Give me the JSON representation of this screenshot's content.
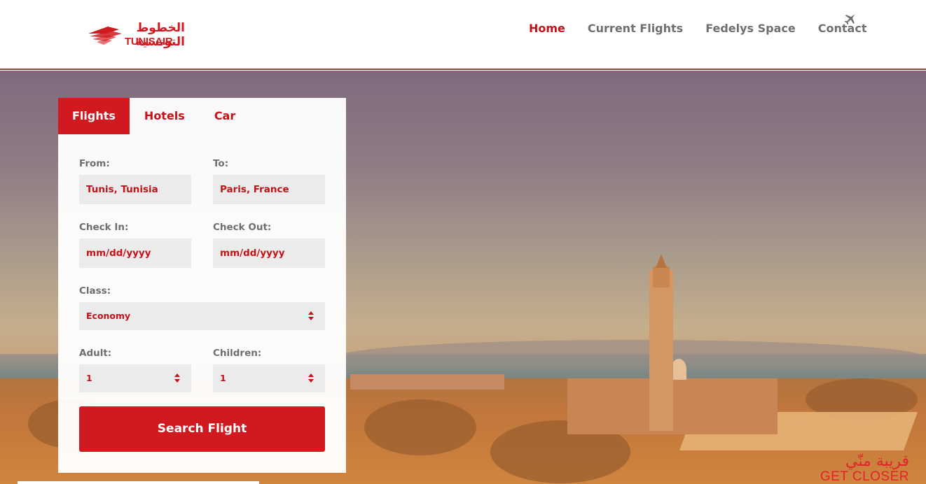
{
  "header": {
    "logo_arabic": "الخطوط التونسية",
    "logo_text": "TUNISAIR",
    "nav": [
      {
        "label": "Home",
        "active": true
      },
      {
        "label": "Current Flights",
        "active": false
      },
      {
        "label": "Fedelys Space",
        "active": false
      },
      {
        "label": "Contact",
        "active": false
      }
    ],
    "nav_icon": "plane-icon"
  },
  "search": {
    "tabs": [
      {
        "label": "Flights",
        "active": true
      },
      {
        "label": "Hotels",
        "active": false
      },
      {
        "label": "Car",
        "active": false
      }
    ],
    "from_label": "From:",
    "from_value": "Tunis, Tunisia",
    "to_label": "To:",
    "to_value": "Paris, France",
    "checkin_label": "Check In:",
    "checkin_value": "mm/dd/yyyy",
    "checkout_label": "Check Out:",
    "checkout_value": "mm/dd/yyyy",
    "class_label": "Class:",
    "class_value": "Economy",
    "adult_label": "Adult:",
    "adult_value": "1",
    "children_label": "Children:",
    "children_value": "1",
    "submit_label": "Search Flight"
  },
  "hero": {
    "tagline_arabic": "قريبة منّي",
    "tagline_en": "GET CLOSER"
  },
  "colors": {
    "brand_red": "#d11a1f",
    "nav_gray": "#6f6f6f",
    "field_bg": "#ebebeb"
  }
}
